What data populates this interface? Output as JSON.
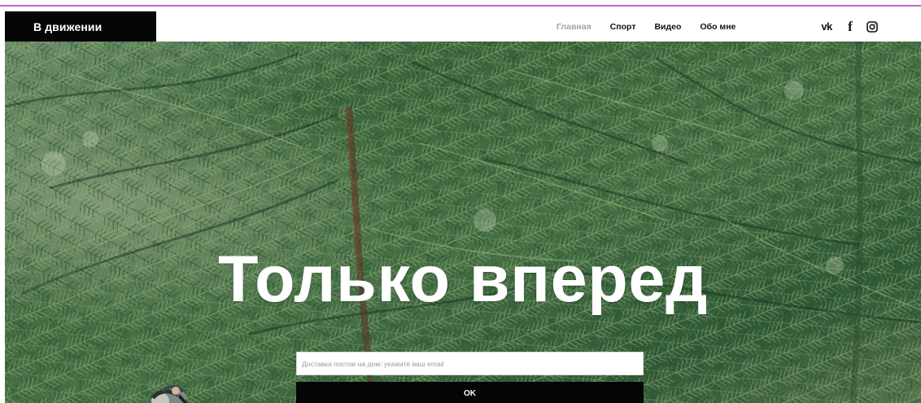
{
  "site": {
    "brand": "В движении",
    "nav": [
      {
        "label": "Главная",
        "active": true
      },
      {
        "label": "Спорт",
        "active": false
      },
      {
        "label": "Видео",
        "active": false
      },
      {
        "label": "Обо мне",
        "active": false
      }
    ],
    "socials": [
      {
        "icon": "vk-icon",
        "label": "vk"
      },
      {
        "icon": "facebook-icon",
        "label": "f"
      },
      {
        "icon": "instagram-icon",
        "label": ""
      }
    ]
  },
  "hero": {
    "title": "Только вперед",
    "subscribe": {
      "placeholder": "Доставка постов на дом: укажите ваш email",
      "button_label": "OK"
    }
  },
  "colors": {
    "accent_line": "#b96ac9",
    "brand_background": "#050505",
    "active_nav": "#a3a3a3",
    "forest_green": "#436b43"
  }
}
